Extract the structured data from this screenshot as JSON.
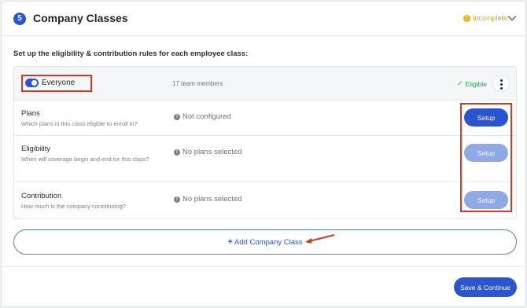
{
  "section": {
    "step_number": "5",
    "title": "Company Classes",
    "status": "Incomplete"
  },
  "intro": "Set up the eligibility & contribution rules for each employee class:",
  "employee_class": {
    "name": "Everyone",
    "toggle_on": true,
    "members": "17 team members",
    "eligibility": "Eligible",
    "rows": [
      {
        "title": "Plans",
        "description": "Which plans is this class eligible to enroll in?",
        "status": "Not configured",
        "button": "Setup",
        "button_enabled": true
      },
      {
        "title": "Eligibility",
        "description": "When will coverage begin and end for this class?",
        "status": "No plans selected",
        "button": "Setup",
        "button_enabled": false
      },
      {
        "title": "Contribution",
        "description": "How much is the company contributing?",
        "status": "No plans selected",
        "button": "Setup",
        "button_enabled": false
      }
    ]
  },
  "add_class_label": "Add Company Class",
  "save_label": "Save & Continue",
  "colors": {
    "primary": "#2b55d0",
    "primary_disabled": "#8fa8e6",
    "warning": "#e9a516",
    "success": "#27a34a",
    "annotation": "#d73a22"
  }
}
